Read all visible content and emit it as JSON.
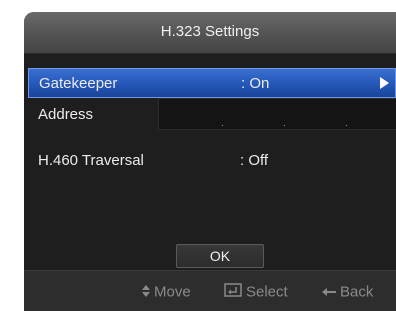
{
  "dialog": {
    "title": "H.323 Settings"
  },
  "rows": [
    {
      "label": "Gatekeeper",
      "value": ": On",
      "selected": true
    },
    {
      "label": "Address",
      "value": ""
    },
    {
      "label": "H.460 Traversal",
      "value": ": Off",
      "selected": false
    }
  ],
  "address": {
    "ip_separators": [
      ".",
      ".",
      "."
    ]
  },
  "ok_button": {
    "label": "OK"
  },
  "footer": {
    "hints": [
      {
        "icon": "updown-arrows-icon",
        "label": "Move"
      },
      {
        "icon": "enter-return-icon",
        "label": "Select"
      },
      {
        "icon": "back-arrow-icon",
        "label": "Back"
      }
    ]
  },
  "colors": {
    "selection": "#2457b8",
    "panel": "#1e1e1e",
    "title_bar": "#575757",
    "footer": "#2d2d2d",
    "text": "#ececec",
    "hint_text": "#8a8a8a"
  }
}
